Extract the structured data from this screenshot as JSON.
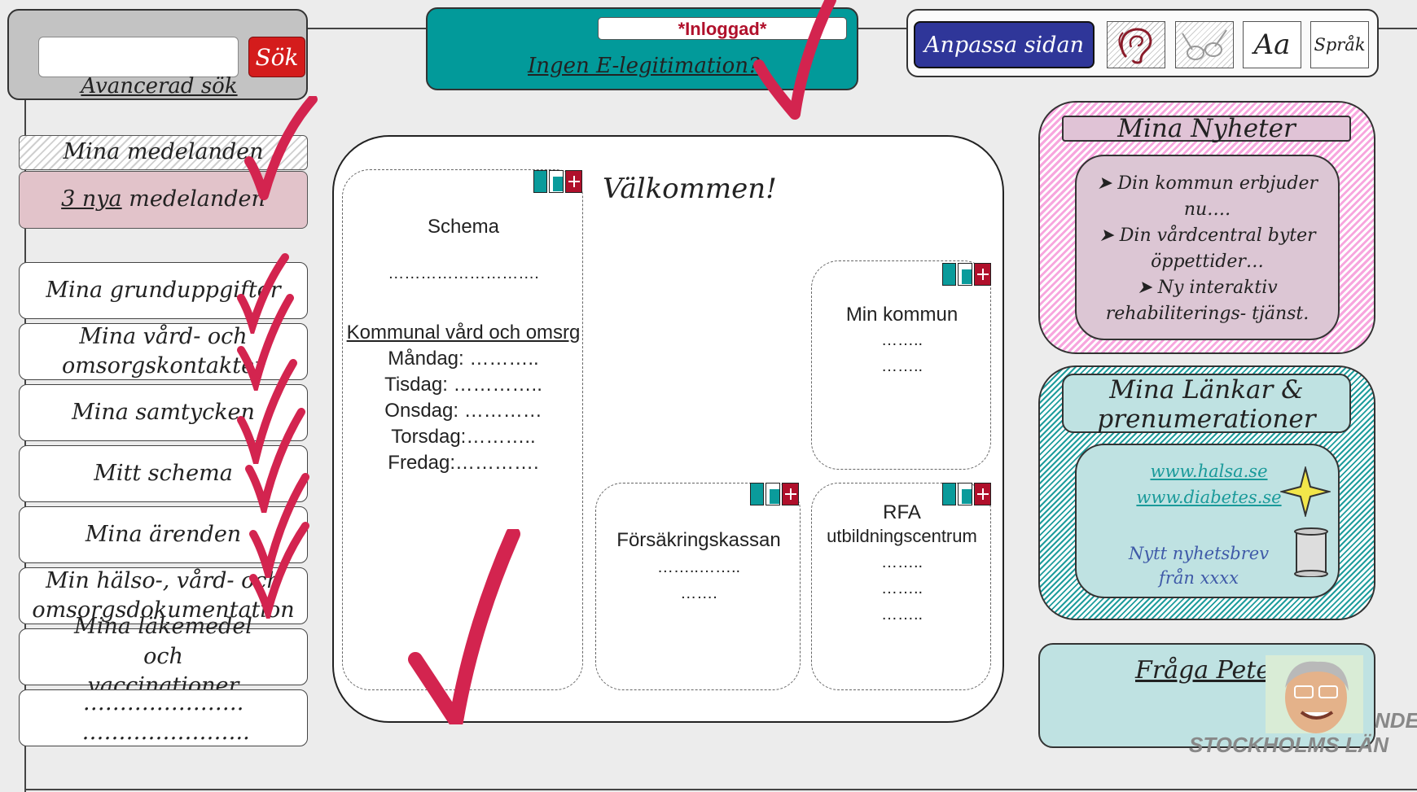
{
  "search": {
    "button_label": "Sök",
    "advanced_label": "Avancerad sök",
    "value": ""
  },
  "login": {
    "status_label": "*Inloggad*",
    "no_eid_label": "Ingen E-legitimation?"
  },
  "toolbar": {
    "customize_label": "Anpassa sidan",
    "font_label": "Aa",
    "language_label": "Språk",
    "icons": [
      "ear-icon",
      "glasses-icon"
    ]
  },
  "sidebar": {
    "messages_header": "Mina medelanden",
    "new_messages_link": "3 nya",
    "new_messages_rest": " medelanden",
    "items": [
      {
        "label": "Mina grunduppgifter"
      },
      {
        "label": "Mina vård- och omsorgskontakter"
      },
      {
        "label": "Mina samtycken"
      },
      {
        "label": "Mitt schema"
      },
      {
        "label": "Mina ärenden"
      },
      {
        "label": "Min hälso-, vård- och omsorgsdokumentation"
      },
      {
        "label": "Mina läkemedel och vaccinationer"
      },
      {
        "label": "…………………. ………………….."
      }
    ]
  },
  "main": {
    "welcome": "Välkommen!",
    "schema": {
      "title": "Schema",
      "dots": "……………………….",
      "subtitle": "Kommunal vård och omsrg",
      "days": [
        "Måndag: ………..",
        "Tisdag: …………..",
        "Onsdag: …………",
        "Torsdag:………..",
        "Fredag:…………."
      ]
    },
    "kommun": {
      "title": "Min kommun",
      "lines": [
        "……..",
        "…….."
      ]
    },
    "fk": {
      "title": "Försäkringskassan",
      "lines": [
        "……..……..",
        "……."
      ]
    },
    "rfa": {
      "title": "RFA",
      "subtitle": "utbildningscentrum",
      "lines": [
        "……..",
        "……..",
        "…….."
      ]
    }
  },
  "news": {
    "title": "Mina Nyheter",
    "items": [
      "Din kommun erbjuder nu….",
      "Din vårdcentral byter öppettider…",
      "Ny interaktiv rehabiliterings- tjänst."
    ]
  },
  "links": {
    "title": "Mina Länkar & prenumerationer",
    "urls": [
      "www.halsa.se",
      "www.diabetes.se"
    ],
    "newsletter": "Nytt nyhetsbrev från xxxx"
  },
  "ask": {
    "label": "Fråga Pete"
  },
  "logo": {
    "line1": "NDE",
    "line2": "STOCKHOLMS LÄN"
  },
  "colors": {
    "accent_teal": "#029a9a",
    "search_red": "#d41c1c",
    "customize_blue": "#2f3699",
    "check_red": "#d3244f",
    "news_pink": "#f7a6de"
  }
}
